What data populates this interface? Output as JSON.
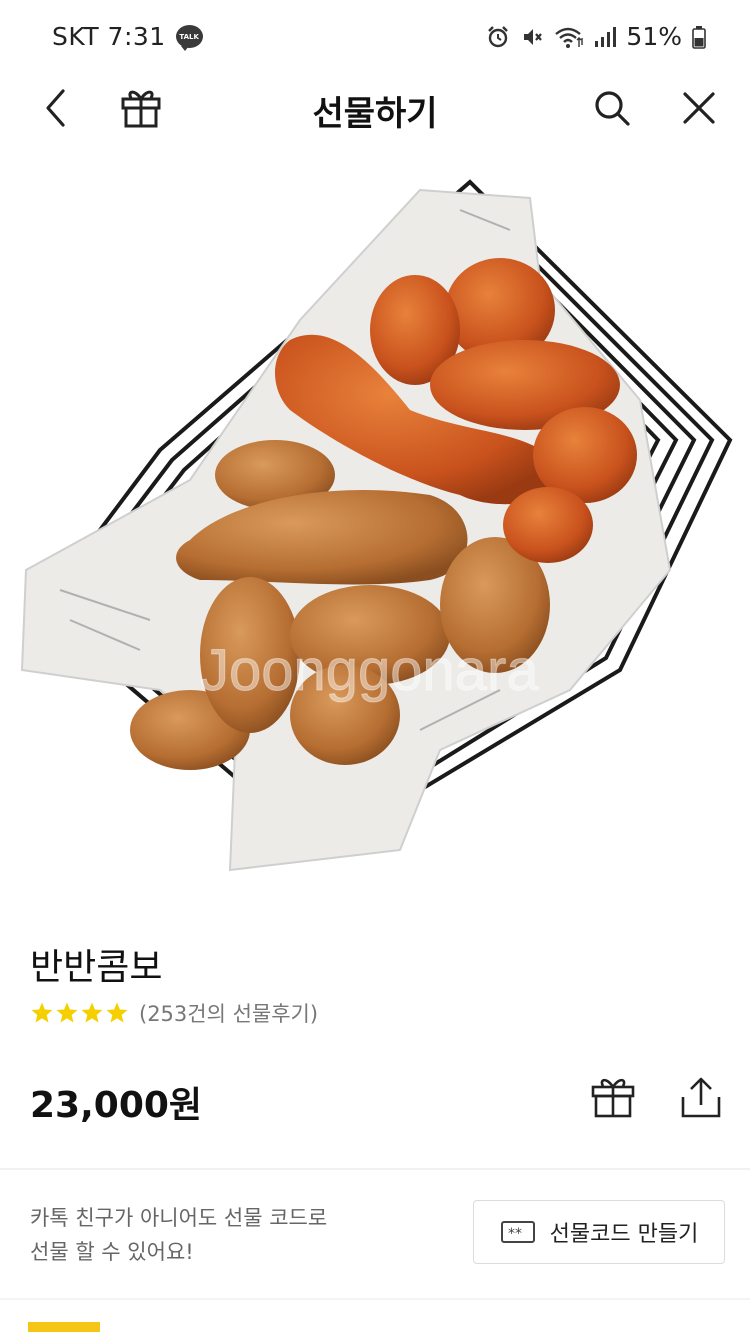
{
  "status_bar": {
    "carrier_time": "SKT 7:31",
    "talk_badge": "TALK",
    "battery_percent": "51%",
    "icons": [
      "alarm-icon",
      "mute-icon",
      "wifi-icon",
      "signal-icon",
      "battery-icon"
    ]
  },
  "header": {
    "title": "선물하기",
    "icons": [
      "back-icon",
      "gift-icon",
      "search-icon",
      "close-icon"
    ]
  },
  "product": {
    "name": "반반콤보",
    "rating_stars": 4,
    "review_count": "(253건의 선물후기)",
    "price": "23,000원",
    "watermark": "Joonggonara"
  },
  "gift_code": {
    "line1": "카톡 친구가 아니어도 선물 코드로",
    "line2": "선물 할 수 있어요!",
    "button_label": "선물코드 만들기"
  },
  "colors": {
    "star": "#f5d000",
    "accent": "#f5c518"
  }
}
